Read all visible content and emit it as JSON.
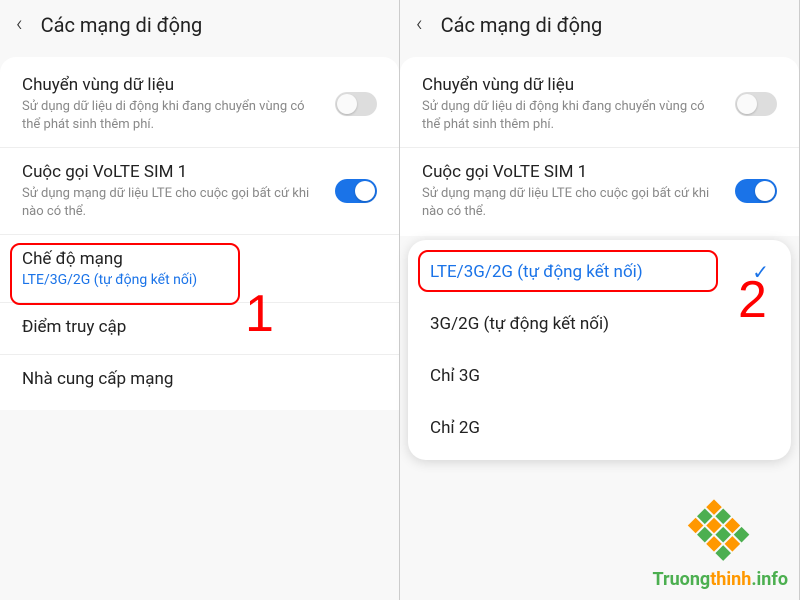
{
  "left": {
    "header": {
      "title": "Các mạng di động"
    },
    "roaming": {
      "title": "Chuyển vùng dữ liệu",
      "desc": "Sử dụng dữ liệu di động khi đang chuyển vùng có thể phát sinh thêm phí."
    },
    "volte": {
      "title": "Cuộc gọi VoLTE SIM 1",
      "desc": "Sử dụng mạng dữ liệu LTE cho cuộc gọi bất cứ khi nào có thể."
    },
    "network_mode": {
      "title": "Chế độ mạng",
      "value": "LTE/3G/2G (tự động kết nối)"
    },
    "apn": {
      "title": "Điểm truy cập"
    },
    "operator": {
      "title": "Nhà cung cấp mạng"
    },
    "anno": "1"
  },
  "right": {
    "header": {
      "title": "Các mạng di động"
    },
    "roaming": {
      "title": "Chuyển vùng dữ liệu",
      "desc": "Sử dụng dữ liệu di động khi đang chuyển vùng có thể phát sinh thêm phí."
    },
    "volte": {
      "title": "Cuộc gọi VoLTE SIM 1",
      "desc": "Sử dụng mạng dữ liệu LTE cho cuộc gọi bất cứ khi nào có thể."
    },
    "dropdown": {
      "options": [
        "LTE/3G/2G (tự động kết nối)",
        "3G/2G (tự động kết nối)",
        "Chỉ 3G",
        "Chỉ 2G"
      ]
    },
    "anno": "2"
  },
  "watermark": {
    "brand1": "Truong",
    "brand2": "thinh",
    "suffix": ".info"
  }
}
